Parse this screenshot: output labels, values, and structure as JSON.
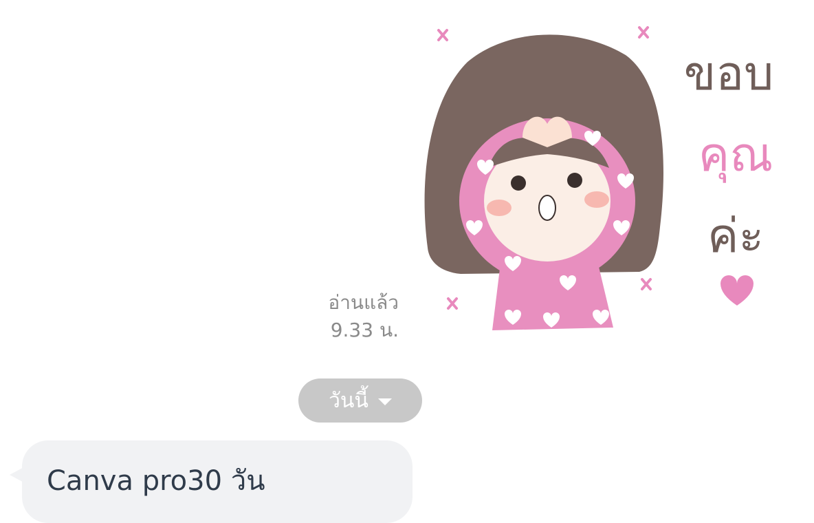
{
  "chat": {
    "sticker": {
      "name": "thank-you-girl-sticker",
      "text_line1": "ขอบ",
      "text_line2": "คุณ",
      "text_line3": "ค่ะ",
      "colors": {
        "hair": "#7a6660",
        "hoodie": "#e88fbf",
        "face": "#fbeee6",
        "pink": "#e889bd"
      }
    },
    "read_receipt": {
      "status": "อ่านแล้ว",
      "time": "9.33 น."
    },
    "date_separator": {
      "label": "วันนี้",
      "icon": "caret-down-icon"
    },
    "incoming_message": {
      "text": "Canva pro30 วัน"
    }
  }
}
